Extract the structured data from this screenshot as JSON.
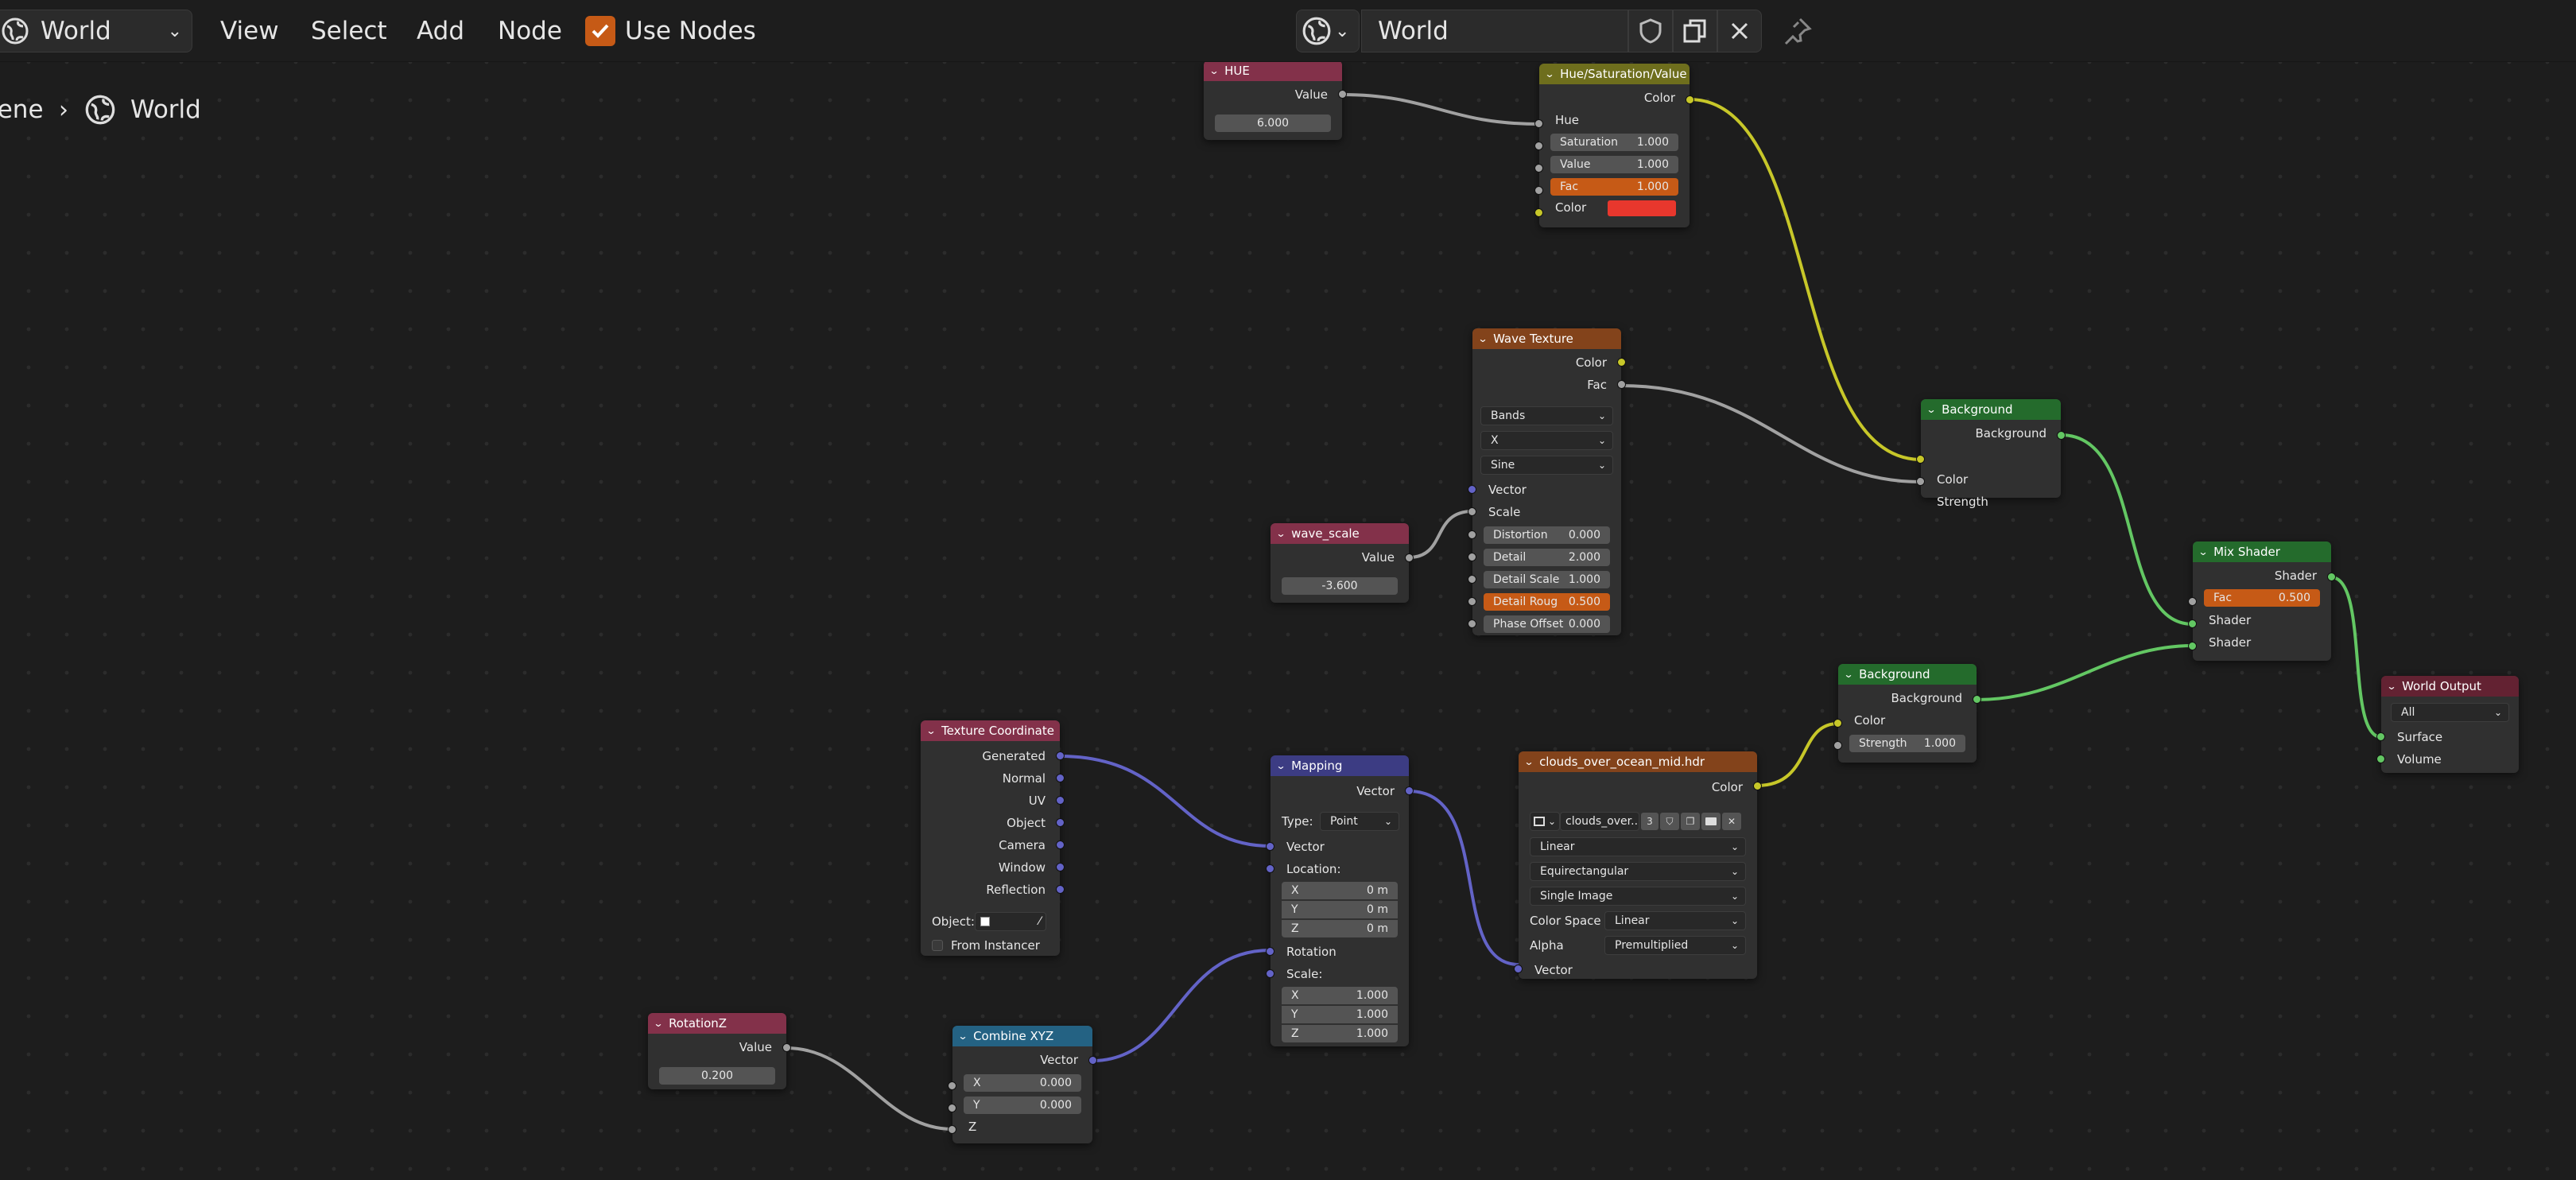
{
  "header": {
    "editor_type": "World",
    "menus": [
      "View",
      "Select",
      "Add",
      "Node"
    ],
    "use_nodes_label": "Use Nodes",
    "use_nodes_checked": true,
    "datablock_name": "World"
  },
  "breadcrumb": {
    "scene": "Scene",
    "world": "World"
  },
  "colors": {
    "accent_check": "#c65a16",
    "socket_color": "#c7c729",
    "socket_vector": "#6363c7",
    "socket_shader": "#63c763",
    "socket_value": "#a1a1a1",
    "hue_color_swatch": "#e8372d"
  },
  "nodes": {
    "hue": {
      "title": "HUE",
      "out_label": "Value",
      "value": "6.000"
    },
    "hsv": {
      "title": "Hue/Saturation/Value",
      "out_label": "Color",
      "hue": "Hue",
      "saturation_label": "Saturation",
      "saturation": "1.000",
      "value_label": "Value",
      "value": "1.000",
      "fac_label": "Fac",
      "fac": "1.000",
      "color_label": "Color"
    },
    "wave": {
      "title": "Wave Texture",
      "out_color": "Color",
      "out_fac": "Fac",
      "type": "Bands",
      "direction": "X",
      "profile": "Sine",
      "vector": "Vector",
      "scale": "Scale",
      "distortion_label": "Distortion",
      "distortion": "0.000",
      "detail_label": "Detail",
      "detail": "2.000",
      "detail_scale_label": "Detail Scale",
      "detail_scale": "1.000",
      "detail_rough_label": "Detail Roug",
      "detail_rough": "0.500",
      "phase_label": "Phase Offset",
      "phase": "0.000"
    },
    "wave_scale": {
      "title": "wave_scale",
      "out_label": "Value",
      "value": "-3.600"
    },
    "bg1": {
      "title": "Background",
      "out_label": "Background",
      "color": "Color",
      "strength": "Strength"
    },
    "mix": {
      "title": "Mix Shader",
      "out_label": "Shader",
      "fac_label": "Fac",
      "fac": "0.500",
      "shader1": "Shader",
      "shader2": "Shader"
    },
    "world_out": {
      "title": "World Output",
      "target": "All",
      "surface": "Surface",
      "volume": "Volume"
    },
    "bg2": {
      "title": "Background",
      "out_label": "Background",
      "color": "Color",
      "strength_label": "Strength",
      "strength": "1.000"
    },
    "texcoord": {
      "title": "Texture Coordinate",
      "outputs": [
        "Generated",
        "Normal",
        "UV",
        "Object",
        "Camera",
        "Window",
        "Reflection"
      ],
      "object_label": "Object:",
      "from_instancer": "From Instancer"
    },
    "mapping": {
      "title": "Mapping",
      "out_label": "Vector",
      "type_label": "Type:",
      "type": "Point",
      "vector": "Vector",
      "location": "Location:",
      "loc": [
        [
          "X",
          "0 m"
        ],
        [
          "Y",
          "0 m"
        ],
        [
          "Z",
          "0 m"
        ]
      ],
      "rotation": "Rotation",
      "scale": "Scale:",
      "scl": [
        [
          "X",
          "1.000"
        ],
        [
          "Y",
          "1.000"
        ],
        [
          "Z",
          "1.000"
        ]
      ]
    },
    "env": {
      "title": "clouds_over_ocean_mid.hdr",
      "out_label": "Color",
      "image_name": "clouds_over...",
      "users": "3",
      "interpolation": "Linear",
      "projection": "Equirectangular",
      "source": "Single Image",
      "color_space_label": "Color Space",
      "color_space": "Linear",
      "alpha_label": "Alpha",
      "alpha": "Premultiplied",
      "vector": "Vector"
    },
    "rotz": {
      "title": "RotationZ",
      "out_label": "Value",
      "value": "0.200"
    },
    "combine": {
      "title": "Combine XYZ",
      "out_label": "Vector",
      "x_label": "X",
      "x": "0.000",
      "y_label": "Y",
      "y": "0.000",
      "z": "Z"
    }
  }
}
